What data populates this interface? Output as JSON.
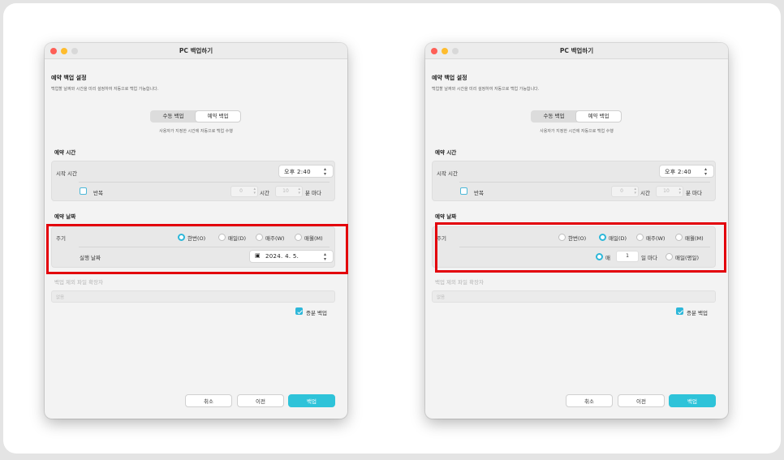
{
  "left": {
    "window_title": "PC 백업하기",
    "section": {
      "title": "예약 백업 설정",
      "subtitle": "백업할 날짜와 시간을 미리 설정하여 자동으로 백업 가능합니다."
    },
    "segment": {
      "manual_label": "수동 백업",
      "scheduled_label": "예약 백업",
      "selected": "예약 백업",
      "description": "사용자가 지정한 시간에 자동으로 백업 수행"
    },
    "schedule_time": {
      "header": "예약 시간",
      "start_label": "시작 시간",
      "start_value": "오후  2:40",
      "repeat_label": "반복",
      "repeat_checked": false,
      "hours_value": "0",
      "hours_unit": "시간",
      "minutes_value": "10",
      "minutes_unit": "분 마다"
    },
    "schedule_date": {
      "header": "예약 날짜",
      "cycle_label": "주기",
      "options": [
        "한번(O)",
        "매일(D)",
        "매주(W)",
        "매월(M)"
      ],
      "selected_option": "한번(O)",
      "run_date_label": "실행 날짜",
      "run_date_value": "2024.  4.  5."
    },
    "exclude": {
      "label": "백업 제외 파일 확장자",
      "placeholder": "없음"
    },
    "incremental": {
      "label": "증분 백업",
      "checked": true
    },
    "buttons": {
      "cancel": "취소",
      "previous": "이전",
      "backup": "백업"
    }
  },
  "right": {
    "window_title": "PC 백업하기",
    "section": {
      "title": "예약 백업 설정",
      "subtitle": "백업할 날짜와 시간을 미리 설정하여 자동으로 백업 가능합니다."
    },
    "segment": {
      "manual_label": "수동 백업",
      "scheduled_label": "예약 백업",
      "selected": "예약 백업",
      "description": "사용자가 지정한 시간에 자동으로 백업 수행"
    },
    "schedule_time": {
      "header": "예약 시간",
      "start_label": "시작 시간",
      "start_value": "오후  2:40",
      "repeat_label": "반복",
      "repeat_checked": false,
      "hours_value": "0",
      "hours_unit": "시간",
      "minutes_value": "10",
      "minutes_unit": "분 마다"
    },
    "schedule_date": {
      "header": "예약 날짜",
      "cycle_label": "주기",
      "options": [
        "한번(O)",
        "매일(D)",
        "매주(W)",
        "매월(M)"
      ],
      "selected_option": "매일(D)",
      "every_prefix": "매",
      "every_days_value": "1",
      "every_suffix": "일 마다",
      "weekday_option": "매일(평일)",
      "selected_daily_mode": "매"
    },
    "exclude": {
      "label": "백업 제외 파일 확장자",
      "placeholder": "없음"
    },
    "incremental": {
      "label": "증분 백업",
      "checked": true
    },
    "buttons": {
      "cancel": "취소",
      "previous": "이전",
      "backup": "백업"
    }
  },
  "colors": {
    "accent": "#2db7d9",
    "highlight": "#e3000b"
  }
}
